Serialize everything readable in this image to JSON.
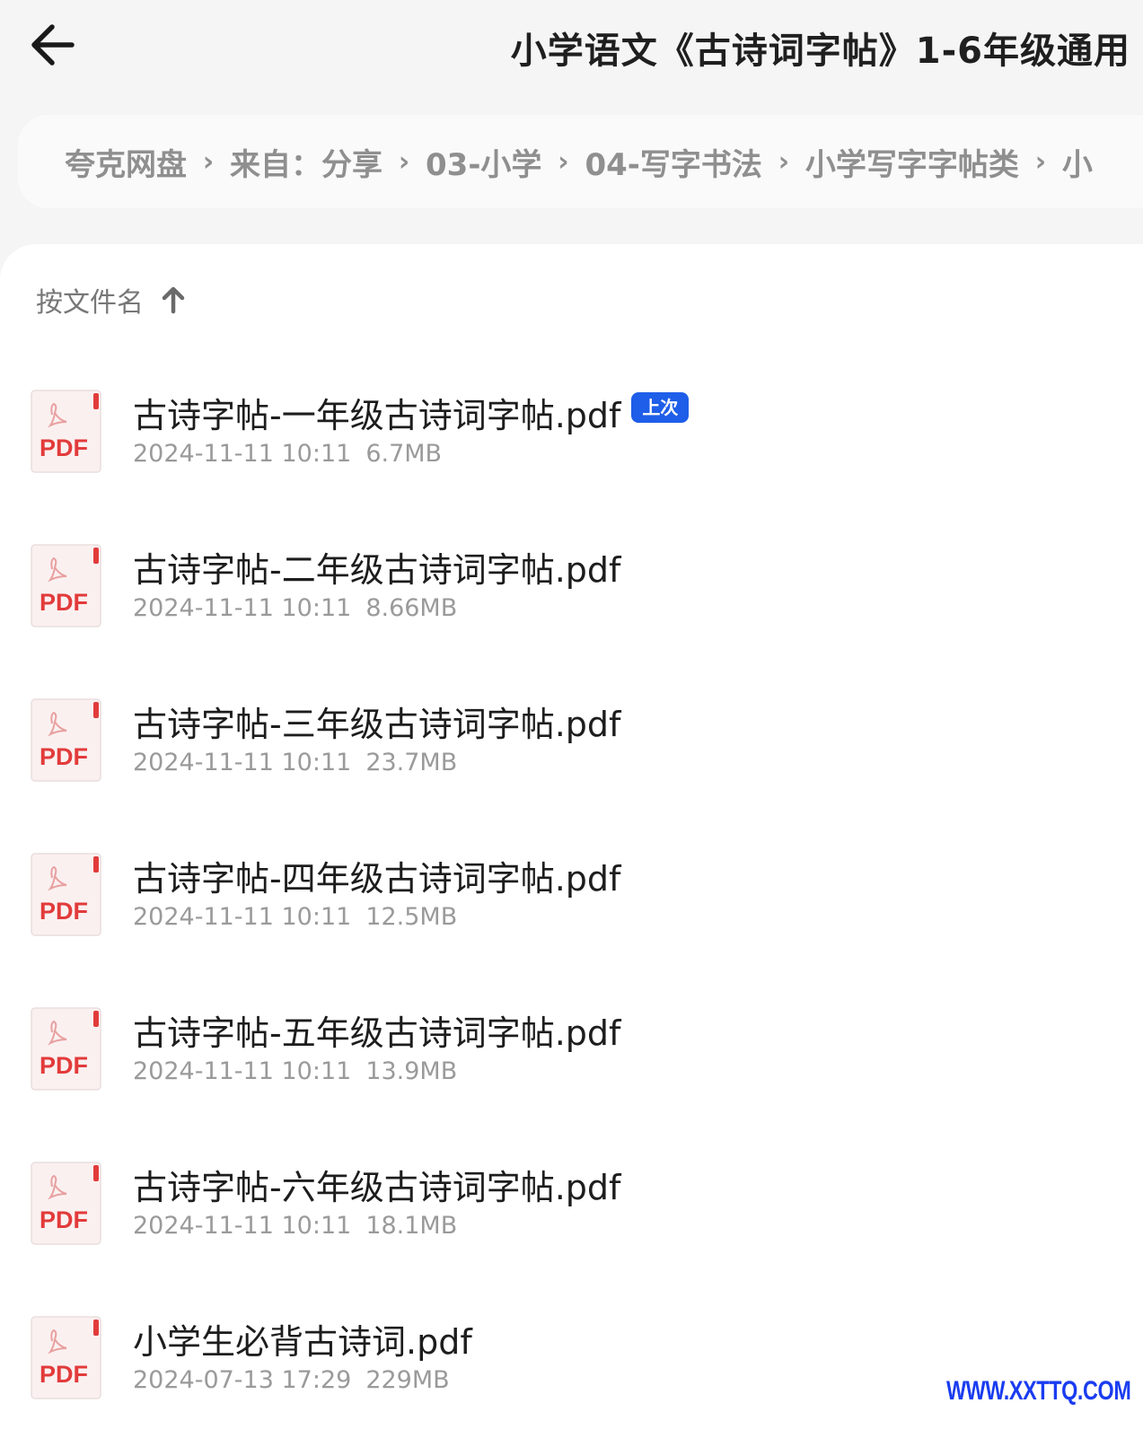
{
  "header": {
    "title": "小学语文《古诗词字帖》1-6年级通用"
  },
  "breadcrumb": {
    "items": [
      "夸克网盘",
      "来自：分享",
      "03-小学",
      "04-写字书法",
      "小学写字字帖类",
      "小"
    ],
    "separator": "›"
  },
  "sort": {
    "label": "按文件名"
  },
  "icons": {
    "file_type": "PDF"
  },
  "files": [
    {
      "name": "古诗字帖-一年级古诗词字帖.pdf",
      "date": "2024-11-11 10:11",
      "size": "6.7MB",
      "badge": "上次"
    },
    {
      "name": "古诗字帖-二年级古诗词字帖.pdf",
      "date": "2024-11-11 10:11",
      "size": "8.66MB"
    },
    {
      "name": "古诗字帖-三年级古诗词字帖.pdf",
      "date": "2024-11-11 10:11",
      "size": "23.7MB"
    },
    {
      "name": "古诗字帖-四年级古诗词字帖.pdf",
      "date": "2024-11-11 10:11",
      "size": "12.5MB"
    },
    {
      "name": "古诗字帖-五年级古诗词字帖.pdf",
      "date": "2024-11-11 10:11",
      "size": "13.9MB"
    },
    {
      "name": "古诗字帖-六年级古诗词字帖.pdf",
      "date": "2024-11-11 10:11",
      "size": "18.1MB"
    },
    {
      "name": "小学生必背古诗词.pdf",
      "date": "2024-07-13 17:29",
      "size": "229MB"
    }
  ],
  "watermark": "WWW.XXTTQ.COM"
}
